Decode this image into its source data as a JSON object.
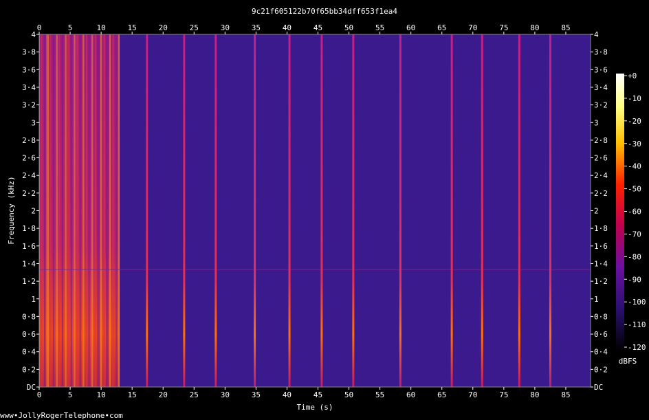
{
  "chart_data": {
    "type": "heatmap",
    "title": "9c21f605122b70f65bb34dff653f1ea4",
    "xlabel": "Time (s)",
    "ylabel": "Frequency (kHz)",
    "xlim": [
      0,
      89
    ],
    "ylim": [
      0,
      4
    ],
    "x_ticks": [
      "0",
      "5",
      "10",
      "15",
      "20",
      "25",
      "30",
      "35",
      "40",
      "45",
      "50",
      "55",
      "60",
      "65",
      "70",
      "75",
      "80",
      "85"
    ],
    "y_ticks": [
      "DC",
      "0·2",
      "0·4",
      "0·6",
      "0·8",
      "1",
      "1·2",
      "1·4",
      "1·6",
      "1·8",
      "2",
      "2·2",
      "2·4",
      "2·6",
      "2·8",
      "3",
      "3·2",
      "3·4",
      "3·6",
      "3·8",
      "4"
    ],
    "colorbar": {
      "label": "dBFS",
      "ticks": [
        "+0",
        "-10",
        "-20",
        "-30",
        "-40",
        "-50",
        "-60",
        "-70",
        "-80",
        "-90",
        "-100",
        "-110",
        "-120"
      ],
      "range": [
        -120,
        0
      ]
    },
    "background_level_dbfs": -95,
    "noisy_region": {
      "start_s": 0,
      "end_s": 13
    },
    "pulse_events_s": [
      17.4,
      23.4,
      28.5,
      34.8,
      40.4,
      45.6,
      50.7,
      58.3,
      66.6,
      71.5,
      77.5,
      82.5
    ],
    "hum_line_khz": 1.33,
    "colors": {
      "background": "#000000",
      "plot_base": "#3a1a8c",
      "accent": "#ff3300"
    }
  },
  "footer": {
    "website": "www•JollyRogerTelephone•com"
  }
}
